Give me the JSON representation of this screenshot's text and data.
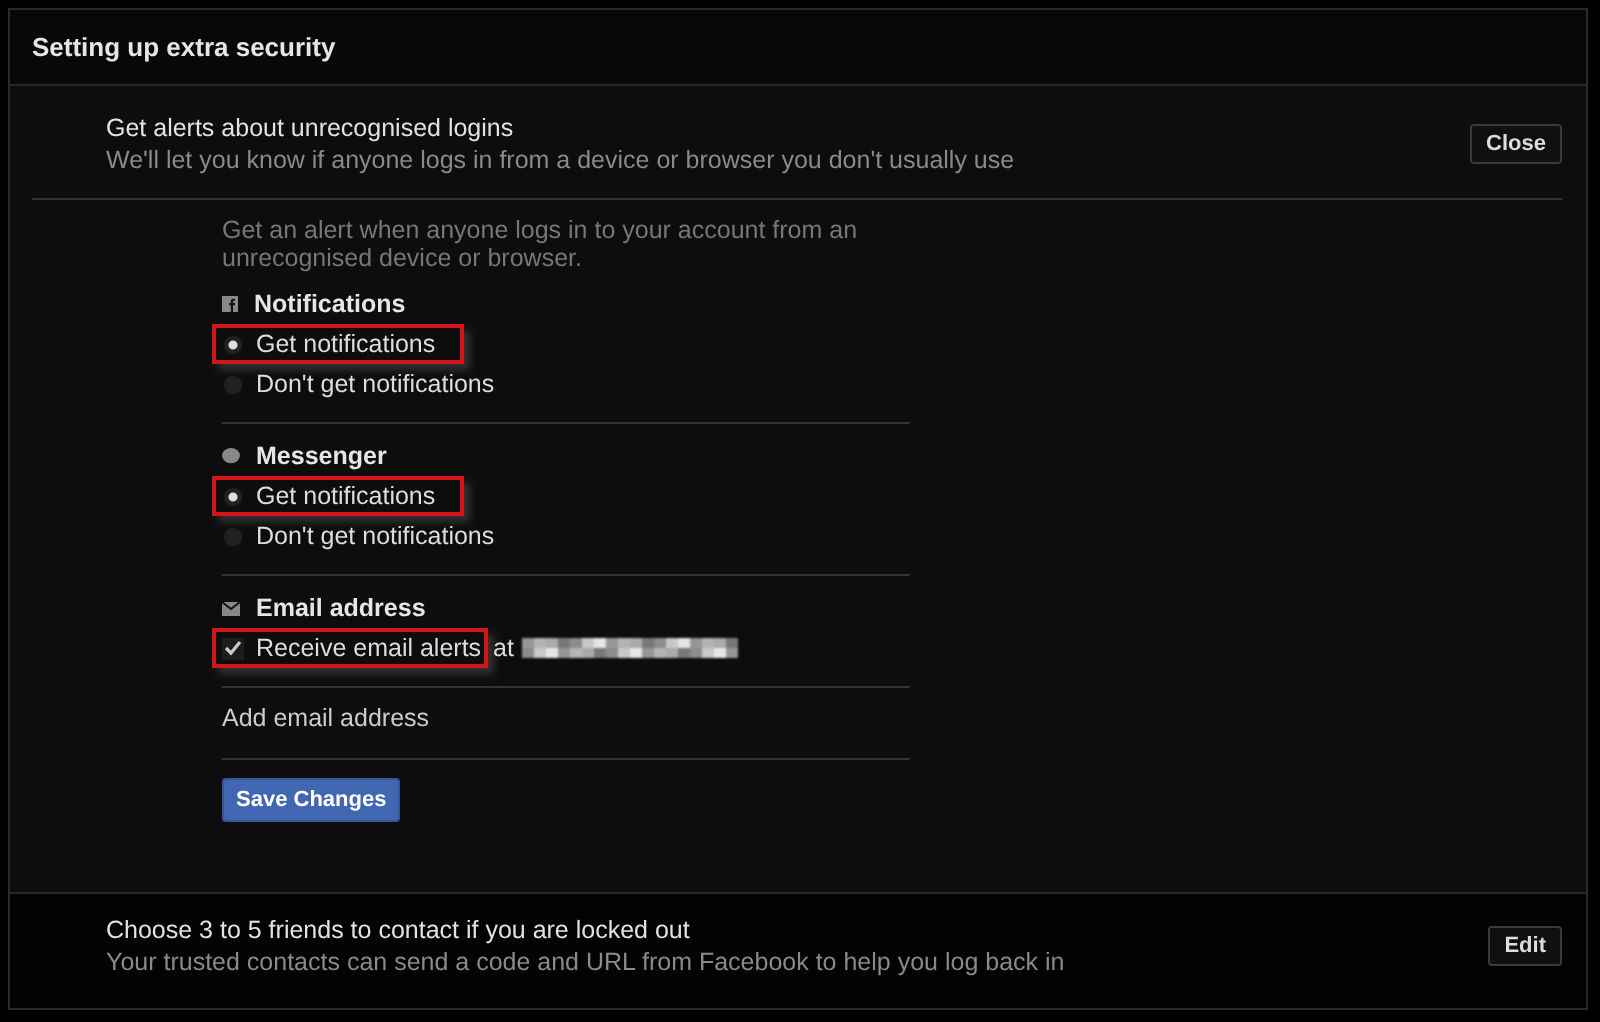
{
  "window": {
    "title": "Setting up extra security"
  },
  "alerts_section": {
    "title": "Get alerts about unrecognised logins",
    "subtitle": "We'll let you know if anyone logs in from a device or browser you don't usually use",
    "button": "Close"
  },
  "intro": "Get an alert when anyone logs in to your account from an unrecognised device or browser.",
  "groups": [
    {
      "title": "Notifications",
      "options": [
        {
          "kind": "radio",
          "label": "Get notifications",
          "selected": true,
          "highlighted": true
        },
        {
          "kind": "radio",
          "label": "Don't get notifications",
          "selected": false,
          "highlighted": false
        }
      ]
    },
    {
      "title": "Messenger",
      "options": [
        {
          "kind": "radio",
          "label": "Get notifications",
          "selected": true,
          "highlighted": true
        },
        {
          "kind": "radio",
          "label": "Don't get notifications",
          "selected": false,
          "highlighted": false
        }
      ]
    },
    {
      "title": "Email address",
      "options": [
        {
          "kind": "checkbox",
          "label": "Receive email alerts",
          "suffix": "at",
          "checked": true,
          "highlighted": true
        }
      ]
    }
  ],
  "add_email": "Add email address",
  "save_button": "Save Changes",
  "contacts_section": {
    "title": "Choose 3 to 5 friends to contact if you are locked out",
    "subtitle": "Your trusted contacts can send a code and URL from Facebook to help you log back in",
    "button": "Edit"
  }
}
